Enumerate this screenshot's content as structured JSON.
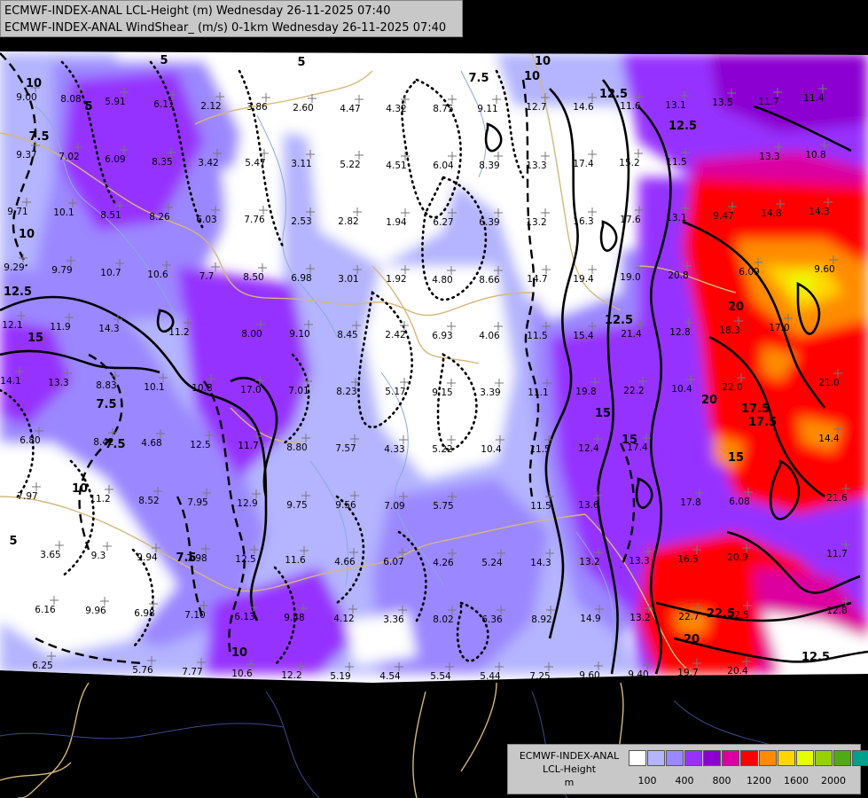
{
  "title": {
    "line1": "ECMWF-INDEX-ANAL LCL-Height (m) Wednesday 26-11-2025 07:40",
    "line2": "ECMWF-INDEX-ANAL WindShear_ (m/s) 0-1km Wednesday 26-11-2025 07:40"
  },
  "legend": {
    "line1": "ECMWF-INDEX-ANAL",
    "line2": "LCL-Height",
    "line3": "m",
    "colors": [
      "#ffffff",
      "#b4b4ff",
      "#9b87ff",
      "#9632ff",
      "#8c00d2",
      "#dc00a0",
      "#ff0000",
      "#ff8c00",
      "#ffd700",
      "#e6ff00",
      "#96d200",
      "#50aa14",
      "#00a08c",
      "#00aaff"
    ],
    "ticks": [
      "100",
      "400",
      "800",
      "1200",
      "1600",
      "2000"
    ]
  },
  "station_values": [
    "9.00",
    "8.08",
    "5.91",
    "6.11",
    "2.12",
    "3.86",
    "2.60",
    "4.47",
    "4.32",
    "8.75",
    "9.11",
    "12.7",
    "14.6",
    "11.6",
    "13.1",
    "13.5",
    "11.7",
    "11.4",
    "9.37",
    "7.02",
    "6.09",
    "8.35",
    "3.42",
    "5.47",
    "3.11",
    "5.22",
    "4.51",
    "6.04",
    "8.39",
    "13.3",
    "17.4",
    "15.2",
    "11.5",
    "13.3",
    "10.8",
    "9.71",
    "10.1",
    "8.51",
    "8.26",
    "6.03",
    "7.76",
    "2.53",
    "2.82",
    "1.94",
    "6.27",
    "6.39",
    "13.2",
    "16.3",
    "17.6",
    "13.1",
    "9.47",
    "14.8",
    "14.3",
    "9.29",
    "9.79",
    "10.7",
    "10.6",
    "7.7",
    "8.50",
    "6.98",
    "3.01",
    "1.92",
    "4.80",
    "8.66",
    "14.7",
    "19.4",
    "19.0",
    "20.8",
    "6.09",
    "9.60",
    "12.1",
    "11.9",
    "14.3",
    "11.2",
    "8.00",
    "9.10",
    "8.45",
    "2.42",
    "6.93",
    "4.06",
    "11.5",
    "15.4",
    "21.4",
    "12.8",
    "18.3",
    "17.0",
    "14.1",
    "13.3",
    "8.83",
    "10.1",
    "10.8",
    "17.0",
    "7.01",
    "8.23",
    "5.17",
    "9.15",
    "3.39",
    "11.1",
    "19.8",
    "22.2",
    "10.4",
    "22.0",
    "21.0",
    "6.80",
    "8.42",
    "4.68",
    "12.5",
    "11.7",
    "8.80",
    "7.57",
    "4.33",
    "5.22",
    "10.4",
    "11.5",
    "12.4",
    "17.4",
    "14.4",
    "7.97",
    "11.2",
    "8.52",
    "7.95",
    "12.9",
    "9.75",
    "9.56",
    "7.09",
    "5.75",
    "11.5",
    "13.6",
    "17.8",
    "6.08",
    "21.6",
    "3.65",
    "9.3",
    "9.94",
    "7.98",
    "12.5",
    "11.6",
    "4.66",
    "6.07",
    "4.26",
    "5.24",
    "14.3",
    "13.2",
    "13.3",
    "16.5",
    "20.9",
    "11.7",
    "6.16",
    "9.96",
    "6.98",
    "7.10",
    "6.13",
    "9.48",
    "4.12",
    "3.36",
    "8.02",
    "6.36",
    "8.92",
    "14.9",
    "13.2",
    "22.7",
    "22.5",
    "12.8",
    "6.25",
    "5.76",
    "7.77",
    "10.6",
    "12.2",
    "5.19",
    "4.54",
    "5.54",
    "5.44",
    "7.25",
    "9.60",
    "9.40",
    "19.7",
    "20.4"
  ],
  "isoline_labels": [
    "10",
    "5",
    "7.5",
    "5",
    "5",
    "10",
    "7.5",
    "12.5",
    "12.5",
    "10",
    "12.5",
    "15",
    "7.5",
    "7.5",
    "10",
    "12.5",
    "15",
    "17.5",
    "20",
    "22.5",
    "17.5",
    "20",
    "15",
    "15",
    "20",
    "12.5",
    "5",
    "10",
    "7.5",
    "10"
  ]
}
